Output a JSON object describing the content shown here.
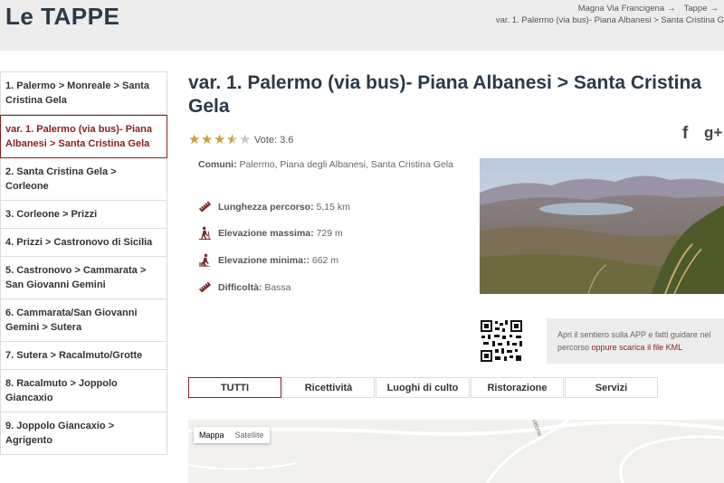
{
  "header": {
    "title": "Le TAPPE",
    "breadcrumb": [
      "Magna Via Francigena",
      "Tappe"
    ],
    "breadcrumb_arrow": "→",
    "breadcrumb_current": "var. 1. Palermo (via bus)- Piana Albanesi > Santa Cristina G"
  },
  "sidebar": {
    "items": [
      {
        "label": "1. Palermo > Monreale > Santa Cristina Gela",
        "active": false
      },
      {
        "label": "var. 1. Palermo (via bus)- Piana Albanesi > Santa Cristina Gela",
        "active": true
      },
      {
        "label": "2. Santa Cristina Gela > Corleone",
        "active": false
      },
      {
        "label": "3. Corleone > Prizzi",
        "active": false
      },
      {
        "label": "4. Prizzi > Castronovo di Sicilia",
        "active": false
      },
      {
        "label": "5. Castronovo > Cammarata > San Giovanni Gemini",
        "active": false
      },
      {
        "label": "6. Cammarata/San Giovanni Gemini > Sutera",
        "active": false
      },
      {
        "label": "7. Sutera > Racalmuto/Grotte",
        "active": false
      },
      {
        "label": "8. Racalmuto > Joppolo Giancaxio",
        "active": false
      },
      {
        "label": "9. Joppolo Giancaxio > Agrigento",
        "active": false
      }
    ]
  },
  "main": {
    "title": "var. 1. Palermo (via bus)- Piana Albanesi > Santa Cristina Gela",
    "rating": {
      "value": 3.6,
      "max": 5,
      "label": "Vote: 3.6",
      "star_color": "#c9a236"
    },
    "comuni_label": "Comuni:",
    "comuni_value": "Palermo, Piana degli Albanesi, Santa Cristina Gela",
    "details": [
      {
        "icon": "ruler-icon",
        "label": "Lunghezza percorso:",
        "value": "5,15 km"
      },
      {
        "icon": "hiker-uphill-icon",
        "label": "Elevazione massima:",
        "value": "729 m"
      },
      {
        "icon": "hiker-downhill-icon",
        "label": "Elevazione minima::",
        "value": "662 m"
      },
      {
        "icon": "ruler-icon",
        "label": "Difficoltà:",
        "value": "Bassa"
      }
    ],
    "social": {
      "facebook": "f",
      "googleplus": "g+"
    },
    "app_text_1": "Apri il sentiero sulla APP e fatti guidare nel",
    "app_text_2": "percorso",
    "app_link": "oppure scarica il file KML",
    "accent_color": "#8a1e1e"
  },
  "tabs": [
    {
      "label": "TUTTI",
      "active": true
    },
    {
      "label": "Ricettività",
      "active": false
    },
    {
      "label": "Luoghi di culto",
      "active": false
    },
    {
      "label": "Ristorazione",
      "active": false
    },
    {
      "label": "Servizi",
      "active": false
    }
  ],
  "map": {
    "type_selected": "Mappa",
    "type_other": "Satellite",
    "road_label": "ebuttone"
  }
}
